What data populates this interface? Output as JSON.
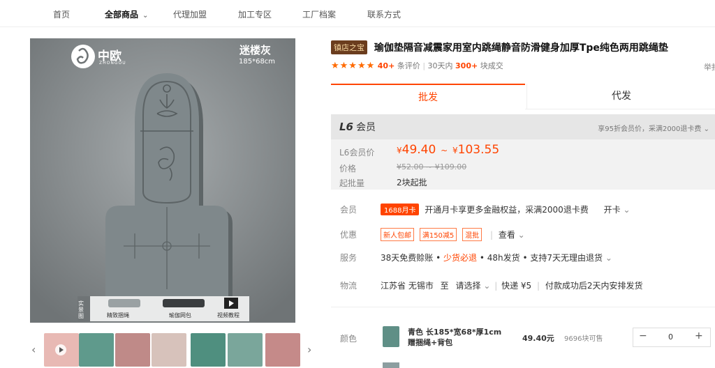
{
  "nav": {
    "items": [
      "首页",
      "全部商品",
      "代理加盟",
      "加工专区",
      "工厂档案",
      "联系方式"
    ],
    "active": "全部商品"
  },
  "gallery": {
    "brand_cn": "中欧",
    "brand_en": "ZHONGOU",
    "color_name": "迷楼灰",
    "size_text": "185*68cm",
    "side_text": "实景图",
    "accessories": [
      "精致捆绳",
      "瑜伽网包",
      "视频教程"
    ]
  },
  "product": {
    "shop_badge": "镇店之宝",
    "title": "瑜伽垫隔音减震家用室内跳绳静音防滑健身加厚Tpe纯色两用跳绳垫",
    "extra": "举报",
    "reviews_count": "40+",
    "reviews_label": "条评价",
    "sep": "|",
    "sold_prefix": "30天内",
    "sold_count": "300+",
    "sold_label": "块成交"
  },
  "tabs": {
    "wholesale": "批发",
    "dropship": "代发"
  },
  "member": {
    "level": "L6",
    "level_label": "会员",
    "tip": "享95折会员价，采满2000退卡费",
    "price_label": "L6会员价",
    "price_low": "49.40",
    "price_high": "103.55",
    "currency": "¥",
    "tilde": "~",
    "orig_label": "价格",
    "orig_price": "¥52.00 ~ ¥109.00",
    "moq_label": "起批量",
    "moq": "2块起批"
  },
  "rows": {
    "member_label": "会员",
    "card_tag": "1688月卡",
    "card_text": "开通月卡享更多金融权益，采满2000退卡费",
    "card_action": "开卡",
    "promo_label": "优惠",
    "promo_tags": [
      "新人包邮",
      "满150减5",
      "混批"
    ],
    "promo_action": "查看",
    "service_label": "服务",
    "service_1": "38天免费赊账",
    "service_2": "少货必退",
    "service_3": "48h发货",
    "service_4": "支持7天无理由退货",
    "dot": "•",
    "logistics_label": "物流",
    "origin": "江苏省 无锡市",
    "to": "至",
    "choose": "请选择",
    "express": "快递 ¥5",
    "ship_note": "付款成功后2天内安排发货"
  },
  "sku": {
    "color_label": "颜色",
    "name_line1": "青色 长185*宽68*厚1cm",
    "name_line2": "赠捆绳+背包",
    "price": "49.40元",
    "stock": "9696块可售",
    "qty": "0",
    "minus": "−",
    "plus": "+"
  },
  "colors": {
    "accent": "#ff4400",
    "brand_dark": "#6b3d1e",
    "mat": "#7d8588"
  }
}
